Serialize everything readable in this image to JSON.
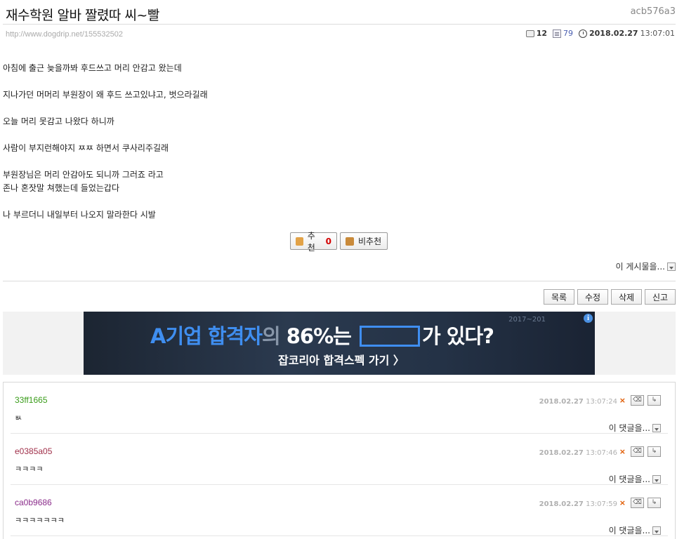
{
  "post": {
    "title": "재수학원 알바 짤렸따 씨~빨",
    "author": "acb576a3",
    "url": "http://www.dogdrip.net/155532502",
    "comment_count": "12",
    "view_count": "79",
    "date": "2018.02.27",
    "time": "13:07:01",
    "lines": [
      "아침에 출근 늦을까봐 후드쓰고 머리 안감고 왔는데",
      "",
      "지나가던 머머리 부원장이 왜 후드 쓰고있냐고, 벗으라길래",
      "",
      "오늘 머리 못감고 나왔다 하니까",
      "",
      "사람이 부지런해야지 ㅉㅉ 하면서 쿠사리주길래",
      "",
      "부원장님은 머리 안감아도 되니까 그러죠 라고",
      "존나 혼잣말 쳐했는데 들었는갑다",
      "",
      "나 부르더니 내일부터 나오지 말라한다 시발"
    ]
  },
  "votes": {
    "up_label": "추천",
    "up_count": "0",
    "down_label": "비추천"
  },
  "post_more": "이 게시물을...",
  "actions": {
    "list": "목록",
    "edit": "수정",
    "delete": "삭제",
    "report": "신고"
  },
  "ad": {
    "headline_part1": "A기업 합격자",
    "headline_part2": "의",
    "headline_part3": "86%는",
    "headline_part4": "가 있다?",
    "sub": "잡코리아 합격스펙 가기 〉",
    "info_glyph": "i",
    "deco_text": "2017~201"
  },
  "comments": [
    {
      "author": "33ff1665",
      "author_color": "#3a9c1a",
      "text": "ㅄ",
      "date": "2018.02.27",
      "time": "13:07:24",
      "more": "이 댓글을..."
    },
    {
      "author": "e0385a05",
      "author_color": "#a0304a",
      "text": "ㅋㅋㅋㅋ",
      "date": "2018.02.27",
      "time": "13:07:46",
      "more": "이 댓글을..."
    },
    {
      "author": "ca0b9686",
      "author_color": "#8a2c8a",
      "text": "ㅋㅋㅋㅋㅋㅋㅋ",
      "date": "2018.02.27",
      "time": "13:07:59",
      "more": "이 댓글을..."
    }
  ],
  "comment_controls": {
    "delete_glyph": "×",
    "edit_glyph": "⌫",
    "reply_glyph": "↳"
  },
  "colors": {
    "accent": "#3f8ef0",
    "vote_count": "#d40000",
    "delete_x": "#e05a00"
  }
}
